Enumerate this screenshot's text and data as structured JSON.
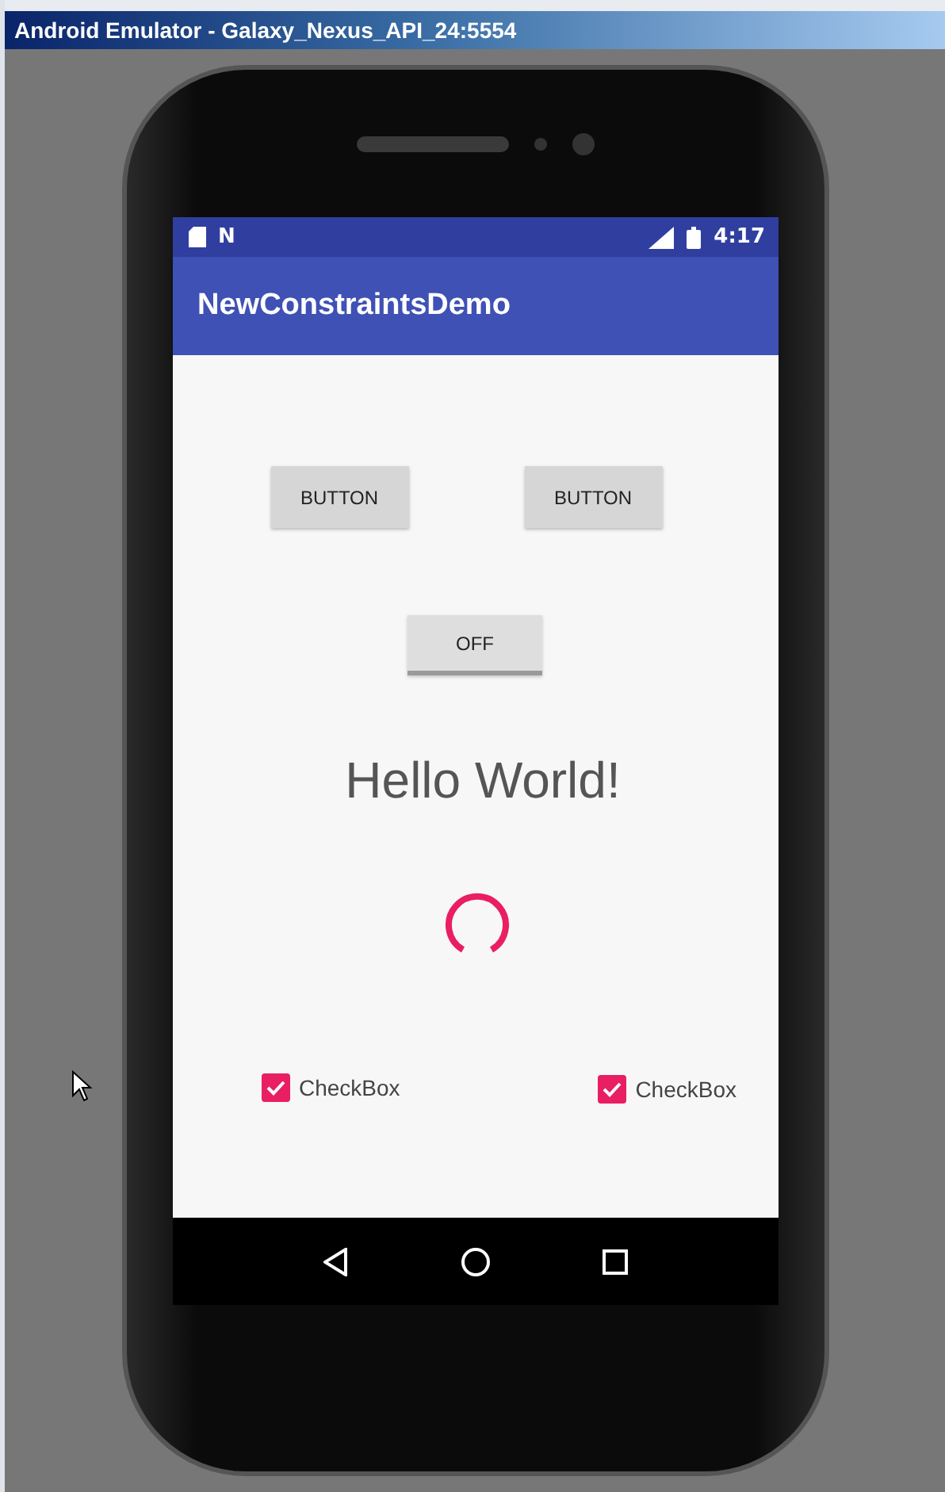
{
  "window": {
    "title": "Android Emulator - Galaxy_Nexus_API_24:5554"
  },
  "status_bar": {
    "notification_glyph": "N",
    "time": "4:17"
  },
  "app_bar": {
    "title": "NewConstraintsDemo"
  },
  "buttons": [
    {
      "label": "BUTTON"
    },
    {
      "label": "BUTTON"
    }
  ],
  "toggle": {
    "label": "OFF",
    "on": false
  },
  "text": "Hello World!",
  "checkboxes": [
    {
      "label": "CheckBox",
      "checked": true
    },
    {
      "label": "CheckBox",
      "checked": true
    }
  ]
}
